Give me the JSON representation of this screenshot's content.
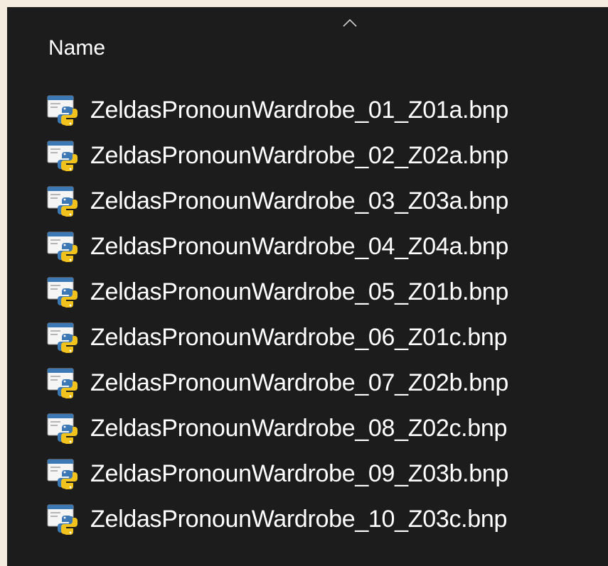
{
  "header": {
    "column_name": "Name",
    "sort_indicator_icon": "chevron-up-icon"
  },
  "file_icon": "python-file-icon",
  "files": [
    {
      "name": "ZeldasPronounWardrobe_01_Z01a.bnp"
    },
    {
      "name": "ZeldasPronounWardrobe_02_Z02a.bnp"
    },
    {
      "name": "ZeldasPronounWardrobe_03_Z03a.bnp"
    },
    {
      "name": "ZeldasPronounWardrobe_04_Z04a.bnp"
    },
    {
      "name": "ZeldasPronounWardrobe_05_Z01b.bnp"
    },
    {
      "name": "ZeldasPronounWardrobe_06_Z01c.bnp"
    },
    {
      "name": "ZeldasPronounWardrobe_07_Z02b.bnp"
    },
    {
      "name": "ZeldasPronounWardrobe_08_Z02c.bnp"
    },
    {
      "name": "ZeldasPronounWardrobe_09_Z03b.bnp"
    },
    {
      "name": "ZeldasPronounWardrobe_10_Z03c.bnp"
    }
  ],
  "colors": {
    "background": "#1c1c1c",
    "text": "#ffffff",
    "outer_border": "#f4ecdf",
    "python_blue": "#3c78b4",
    "python_yellow": "#f2c21c"
  }
}
